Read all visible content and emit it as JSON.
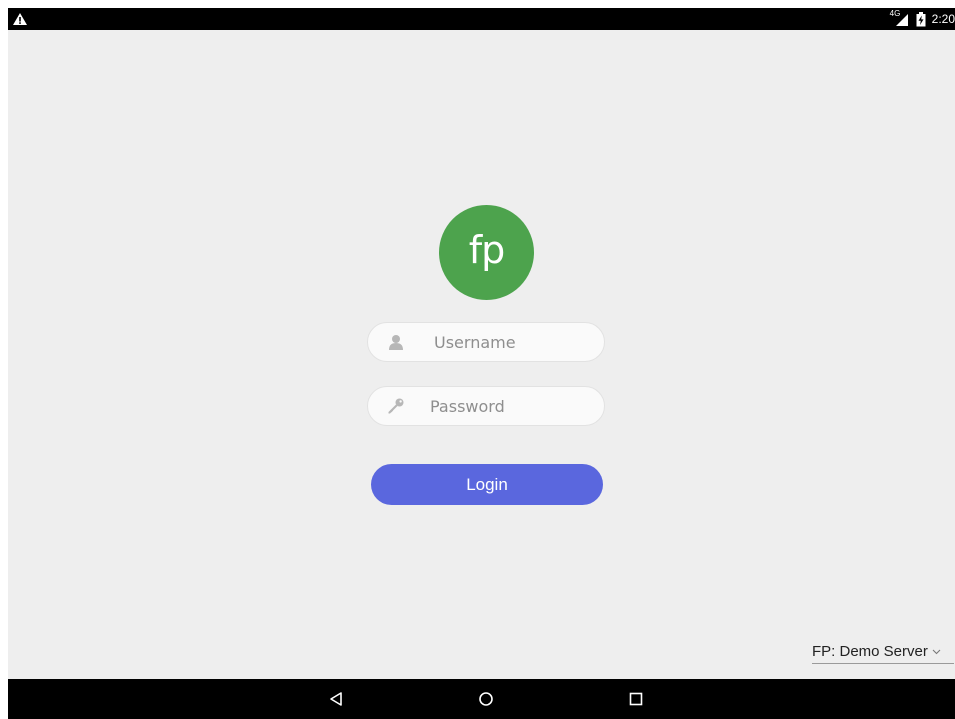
{
  "status_bar": {
    "left_icon": "warning-icon",
    "network": "4G",
    "signal_icon": "signal-icon",
    "battery_icon": "battery-charging-icon",
    "time": "2:20"
  },
  "logo": {
    "text": "fp",
    "color": "#4da34d"
  },
  "login_form": {
    "username": {
      "placeholder": "Username",
      "value": "",
      "icon": "user-icon"
    },
    "password": {
      "placeholder": "Password",
      "value": "",
      "icon": "key-icon"
    },
    "login_label": "Login",
    "login_color": "#5a67de"
  },
  "server_selector": {
    "value": "FP: Demo Server",
    "icon": "chevron-down-icon"
  },
  "nav_bar": {
    "back_icon": "back-icon",
    "home_icon": "home-icon",
    "recents_icon": "recents-icon"
  }
}
